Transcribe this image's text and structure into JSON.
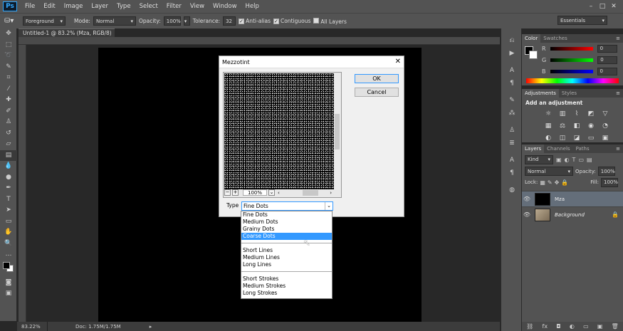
{
  "app": {
    "logo": "Ps"
  },
  "menu": [
    "File",
    "Edit",
    "Image",
    "Layer",
    "Type",
    "Select",
    "Filter",
    "View",
    "Window",
    "Help"
  ],
  "window_controls": [
    "–",
    "□",
    "✕"
  ],
  "options_bar": {
    "tool_icon": "paint-bucket-icon",
    "fill_source": "Foreground",
    "mode_label": "Mode:",
    "mode_value": "Normal",
    "opacity_label": "Opacity:",
    "opacity_value": "100%",
    "tolerance_label": "Tolerance:",
    "tolerance_value": "32",
    "anti_alias_label": "Anti-alias",
    "anti_alias_checked": true,
    "contiguous_label": "Contiguous",
    "contiguous_checked": true,
    "all_layers_label": "All Layers",
    "all_layers_checked": false,
    "workspace": "Essentials"
  },
  "document": {
    "tab_title": "Untitled-1 @ 83.2% (Mza, RGB/8) *",
    "tab_close": "×"
  },
  "status": {
    "zoom": "83.22%",
    "doc": "Doc: 1.75M/1.75M"
  },
  "color_panel": {
    "tabs": [
      "Color",
      "Swatches"
    ],
    "channels": [
      {
        "label": "R",
        "value": "0",
        "color": "#ff0000"
      },
      {
        "label": "G",
        "value": "0",
        "color": "#00ff00"
      },
      {
        "label": "B",
        "value": "0",
        "color": "#0000ff"
      }
    ]
  },
  "adjustments_panel": {
    "tabs": [
      "Adjustments",
      "Styles"
    ],
    "heading": "Add an adjustment"
  },
  "layers_panel": {
    "tabs": [
      "Layers",
      "Channels",
      "Paths"
    ],
    "kind_filter": "Kind",
    "blend_mode": "Normal",
    "opacity_label": "Opacity:",
    "opacity_value": "100%",
    "lock_label": "Lock:",
    "fill_label": "Fill:",
    "fill_value": "100%",
    "layers": [
      {
        "name": "Mza",
        "selected": true
      },
      {
        "name": "Background",
        "selected": false
      }
    ]
  },
  "dialog": {
    "title": "Mezzotint",
    "close": "✕",
    "ok_label": "OK",
    "cancel_label": "Cancel",
    "zoom_value": "100%",
    "zoom_out": "−",
    "zoom_in": "+",
    "type_label": "Type",
    "type_value": "Fine Dots",
    "type_options_group1": [
      "Fine Dots",
      "Medium Dots",
      "Grainy Dots",
      "Coarse Dots"
    ],
    "type_options_group2": [
      "Short Lines",
      "Medium Lines",
      "Long Lines"
    ],
    "type_options_group3": [
      "Short Strokes",
      "Medium Strokes",
      "Long Strokes"
    ],
    "highlighted_option": "Coarse Dots"
  },
  "colors": {
    "accent": "#3399ff",
    "chrome": "#535353",
    "canvas": "#000000"
  }
}
